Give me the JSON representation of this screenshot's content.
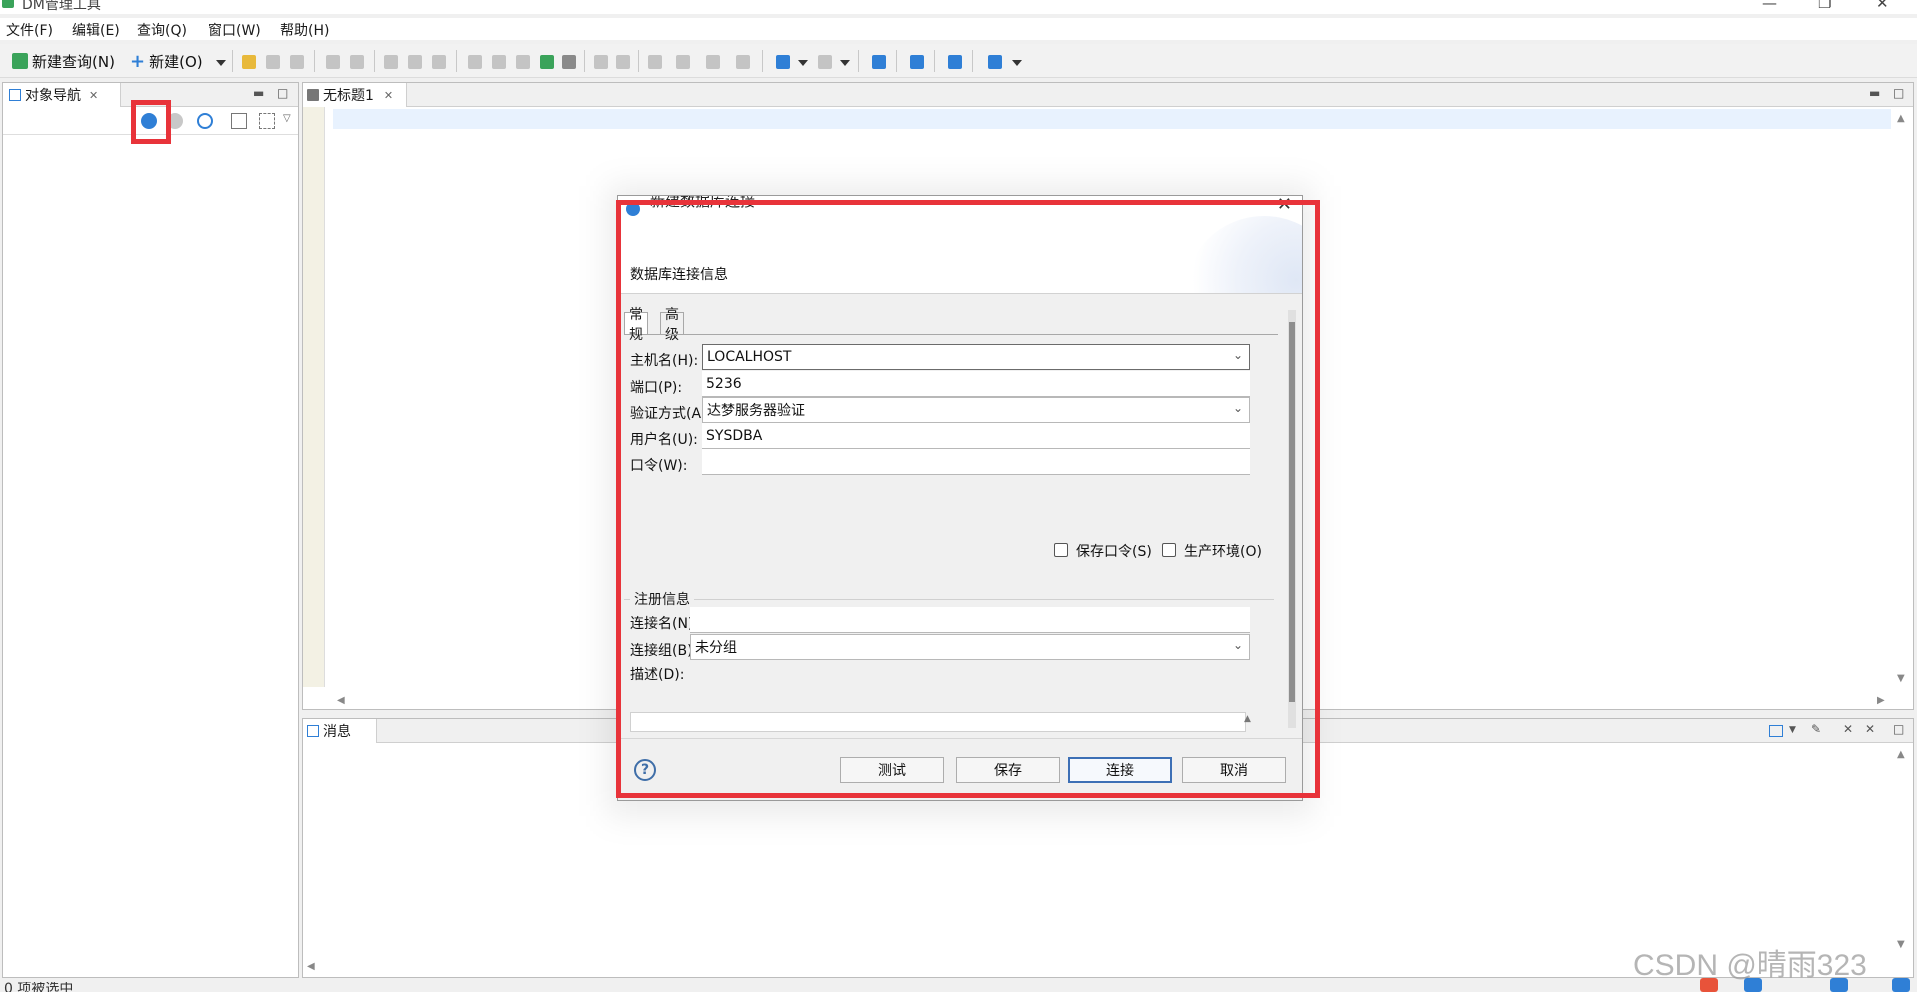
{
  "window": {
    "title": "DM管理工具"
  },
  "menu": [
    "文件(F)",
    "编辑(E)",
    "查询(Q)",
    "窗口(W)",
    "帮助(H)"
  ],
  "toolbar": {
    "new_query": "新建查询(N)",
    "new": "新建(O)"
  },
  "navigator": {
    "tab_label": "对象导航"
  },
  "editor": {
    "tab_label": "无标题1"
  },
  "messages": {
    "tab_label": "消息"
  },
  "status": {
    "text": "0 项被选中"
  },
  "watermark": "CSDN @晴雨323",
  "dialog": {
    "title": "新建数据库连接",
    "subtitle": "数据库连接信息",
    "tabs": [
      "常规",
      "高级"
    ],
    "fields": {
      "host_label": "主机名(H):",
      "host_value": "LOCALHOST",
      "port_label": "端口(P):",
      "port_value": "5236",
      "auth_label": "验证方式(A):",
      "auth_value": "达梦服务器验证",
      "user_label": "用户名(U):",
      "user_value": "SYSDBA",
      "password_label": "口令(W):",
      "password_value": ""
    },
    "checkboxes": {
      "save_password": "保存口令(S)",
      "production": "生产环境(O)"
    },
    "registration": {
      "group_title": "注册信息",
      "conn_name_label": "连接名(N):",
      "conn_name_value": "",
      "conn_group_label": "连接组(B):",
      "conn_group_value": "未分组",
      "desc_label": "描述(D):"
    },
    "buttons": {
      "test": "测试",
      "save": "保存",
      "connect": "连接",
      "cancel": "取消"
    }
  },
  "colors": {
    "highlight": "#e8333a",
    "accent": "#3d6fb5"
  }
}
